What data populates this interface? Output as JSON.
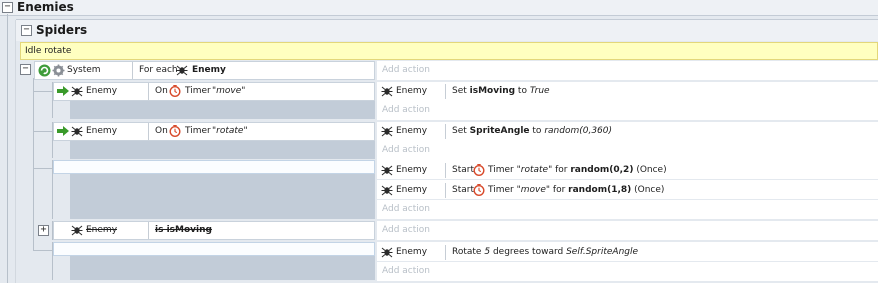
{
  "group": {
    "title": "Enemies"
  },
  "subgroup": {
    "title": "Spiders"
  },
  "comment": {
    "text": "Idle rotate"
  },
  "parent_event": {
    "object": "System",
    "condition_prefix": "For each",
    "condition_object": "Enemy",
    "add_action": "Add action"
  },
  "events": [
    {
      "object": "Enemy",
      "condition_prefix": "On",
      "condition_text": "Timer",
      "condition_param": "\"move\"",
      "actions": [
        {
          "object": "Enemy",
          "prefix": "Set",
          "bold": "isMoving",
          "mid": "to",
          "italic": "True"
        }
      ],
      "add_action": "Add action"
    },
    {
      "object": "Enemy",
      "condition_prefix": "On",
      "condition_text": "Timer",
      "condition_param": "\"rotate\"",
      "actions": [
        {
          "object": "Enemy",
          "prefix": "Set",
          "bold": "SpriteAngle",
          "mid": "to",
          "italic": "random(0,360)"
        }
      ],
      "add_action": "Add action"
    },
    {
      "actions": [
        {
          "object": "Enemy",
          "prefix": "Start",
          "timer": "Timer",
          "param": "\"rotate\"",
          "mid": "for",
          "bold": "random(0,2)",
          "suffix": "(Once)"
        },
        {
          "object": "Enemy",
          "prefix": "Start",
          "timer": "Timer",
          "param": "\"move\"",
          "mid": "for",
          "bold": "random(1,8)",
          "suffix": "(Once)"
        }
      ],
      "add_action": "Add action"
    },
    {
      "object": "Enemy",
      "condition_text": "is isMoving",
      "add_action": "Add action"
    },
    {
      "actions": [
        {
          "object": "Enemy",
          "prefix": "Rotate",
          "num": "5",
          "mid": "degrees toward",
          "italic": "Self.SpriteAngle"
        }
      ],
      "add_action": "Add action"
    }
  ],
  "colors": {
    "comment_bg": "#ffffc0",
    "timer_red": "#d84a2b",
    "trigger_green": "#3a9a2a"
  }
}
